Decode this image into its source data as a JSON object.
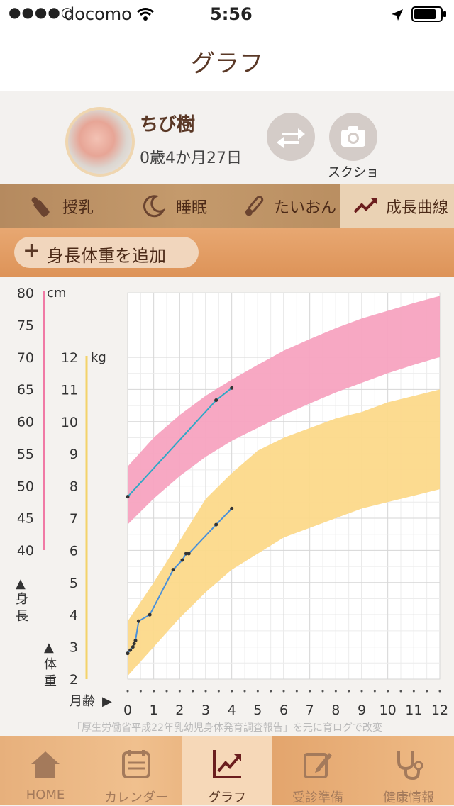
{
  "status_bar": {
    "signal": "●●●●○",
    "carrier": "docomo",
    "time": "5:56"
  },
  "nav": {
    "title": "グラフ"
  },
  "profile": {
    "name": "ちび樹",
    "age": "0歳4か月27日",
    "camera_label": "スクショ"
  },
  "tabs": [
    {
      "label": "授乳",
      "icon": "bottle-icon"
    },
    {
      "label": "睡眠",
      "icon": "moon-icon"
    },
    {
      "label": "たいおん",
      "icon": "thermometer-icon"
    },
    {
      "label": "成長曲線",
      "icon": "trend-icon",
      "selected": true
    }
  ],
  "add_button": {
    "plus": "+",
    "label": "身長体重を追加"
  },
  "chart_data": {
    "type": "line",
    "x_axis": {
      "label": "月齢",
      "ticks": [
        "0",
        "1",
        "2",
        "3",
        "4",
        "5",
        "6",
        "7",
        "8",
        "9",
        "10",
        "11",
        "12"
      ],
      "range": [
        0,
        12
      ]
    },
    "height_axis": {
      "unit": "cm",
      "ticks": [
        "80",
        "75",
        "70",
        "65",
        "60",
        "55",
        "50",
        "45",
        "40"
      ],
      "range": [
        40,
        80
      ],
      "label": "身長"
    },
    "weight_axis": {
      "unit": "kg",
      "ticks": [
        "12",
        "11",
        "10",
        "9",
        "8",
        "7",
        "6",
        "5",
        "4",
        "3",
        "2"
      ],
      "range": [
        2,
        12
      ],
      "label": "体重"
    },
    "height_band": {
      "color": "#f7a3c0",
      "x": [
        0,
        1,
        2,
        3,
        4,
        5,
        6,
        7,
        8,
        9,
        10,
        11,
        12
      ],
      "lower": [
        44.0,
        48.0,
        51.5,
        54.5,
        57.0,
        59.0,
        61.0,
        62.8,
        64.5,
        66.0,
        67.5,
        68.8,
        70.0
      ],
      "upper": [
        53.0,
        57.5,
        61.0,
        64.0,
        66.5,
        68.8,
        71.0,
        72.8,
        74.5,
        76.0,
        77.2,
        78.4,
        79.5
      ]
    },
    "weight_band": {
      "color": "#fcd98a",
      "x": [
        0,
        1,
        2,
        3,
        4,
        5,
        6,
        7,
        8,
        9,
        10,
        11,
        12
      ],
      "lower": [
        2.1,
        3.0,
        3.9,
        4.7,
        5.4,
        5.9,
        6.4,
        6.7,
        7.0,
        7.3,
        7.5,
        7.7,
        7.9
      ],
      "upper": [
        3.8,
        5.0,
        6.3,
        7.6,
        8.4,
        9.1,
        9.5,
        9.8,
        10.1,
        10.3,
        10.6,
        10.8,
        11.0
      ]
    },
    "series": [
      {
        "name": "身長",
        "axis": "height",
        "color": "#2ea8c6",
        "x": [
          0,
          3.4,
          4.0
        ],
        "values": [
          48.3,
          63.3,
          65.2
        ]
      },
      {
        "name": "体重",
        "axis": "weight",
        "color": "#4a90d9",
        "x": [
          0,
          0.1,
          0.2,
          0.25,
          0.3,
          0.42,
          0.85,
          1.75,
          2.1,
          2.25,
          2.35,
          3.4,
          4.0
        ],
        "values": [
          2.8,
          2.9,
          3.0,
          3.1,
          3.2,
          3.8,
          4.0,
          5.4,
          5.7,
          5.9,
          5.9,
          6.8,
          7.3
        ]
      }
    ],
    "credit": "「厚生労働省平成22年乳幼児身体発育調査報告」を元に育ログで改変"
  },
  "tabbar": [
    {
      "label": "HOME",
      "icon": "home-icon"
    },
    {
      "label": "カレンダー",
      "icon": "calendar-icon"
    },
    {
      "label": "グラフ",
      "icon": "chart-icon",
      "selected": true
    },
    {
      "label": "受診準備",
      "icon": "edit-icon"
    },
    {
      "label": "健康情報",
      "icon": "stethoscope-icon"
    }
  ]
}
